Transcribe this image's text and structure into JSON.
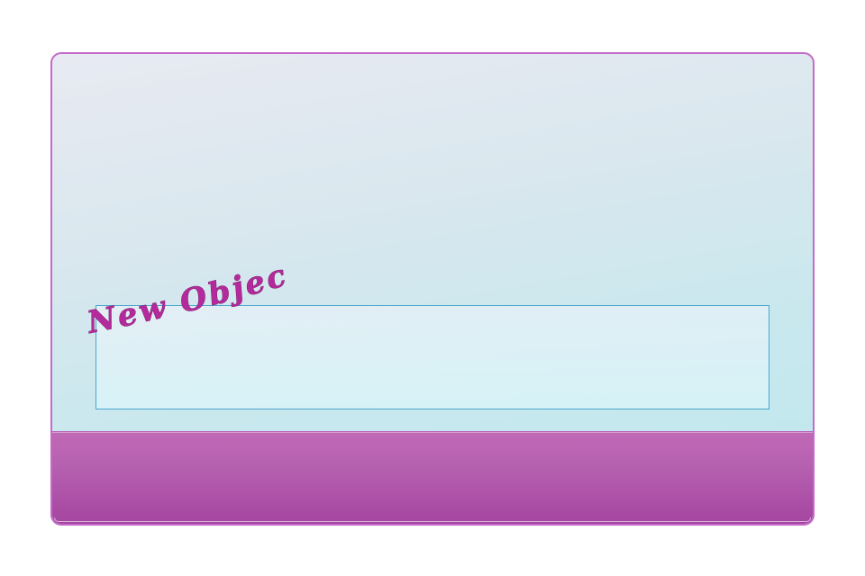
{
  "wordart": {
    "text": "New Object"
  },
  "colors": {
    "frame_border": "#c46ac9",
    "bottom_bar": "#b55fb0",
    "wordart_fill": "#b42a9c",
    "text_box_border": "#4aa6cc"
  }
}
